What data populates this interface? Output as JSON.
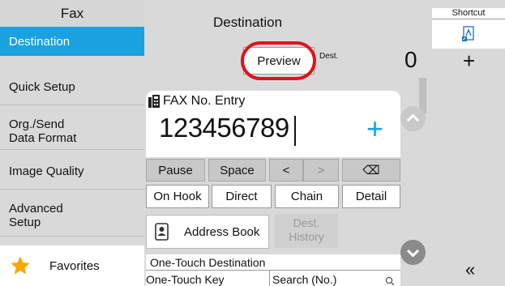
{
  "sidebar": {
    "title": "Fax",
    "items": [
      {
        "label": "Destination"
      },
      {
        "label": "Quick Setup"
      },
      {
        "label": "Org./Send\nData Format"
      },
      {
        "label": "Image Quality"
      },
      {
        "label": "Advanced\nSetup"
      }
    ],
    "favorites_label": "Favorites"
  },
  "main": {
    "title": "Destination",
    "preview_label": "Preview",
    "dest_label": "Dest.",
    "dest_count": "0",
    "fax_entry_label": "FAX No. Entry",
    "fax_number": "123456789",
    "keys_row1": [
      "Pause",
      "Space",
      "<",
      ">",
      "⌫"
    ],
    "keys_row2": [
      "On Hook",
      "Direct",
      "Chain",
      "Detail"
    ],
    "address_book_label": "Address Book",
    "dest_history_label": "Dest.\nHistory",
    "onetouch_title": "One-Touch Destination",
    "onetouch_key_label": "One-Touch Key",
    "onetouch_search_label": "Search (No.)"
  },
  "shortcut": {
    "title": "Shortcut",
    "icon": "document-shortcut-icon"
  },
  "colors": {
    "accent": "#1aa2e0",
    "highlight_ring": "#e0121b",
    "favorites_star": "#f5a800"
  }
}
